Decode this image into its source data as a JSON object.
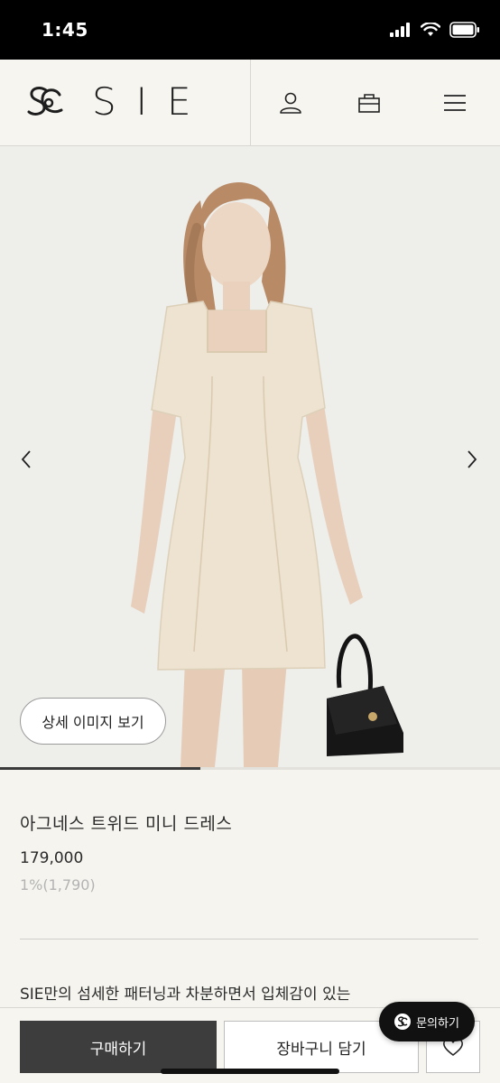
{
  "status_bar": {
    "time": "1:45"
  },
  "header": {
    "brand": "SIE",
    "icons": [
      "user-icon",
      "shopping-bag-icon",
      "menu-icon"
    ]
  },
  "hero": {
    "detail_button_label": "상세 이미지 보기",
    "slide_progress": 0.4
  },
  "product": {
    "name": "아그네스 트위드 미니 드레스",
    "price": "179,000",
    "points": "1%(1,790)",
    "description_preview": "SIE만의 섬세한 패터닝과 차분하면서 입체감이 있는"
  },
  "actions": {
    "buy_label": "구매하기",
    "cart_label": "장바구니 담기",
    "inquiry_label": "문의하기"
  },
  "colors": {
    "background": "#f5f4ef",
    "primary_button": "#3d3d3d",
    "dress": "#ede3d0"
  }
}
